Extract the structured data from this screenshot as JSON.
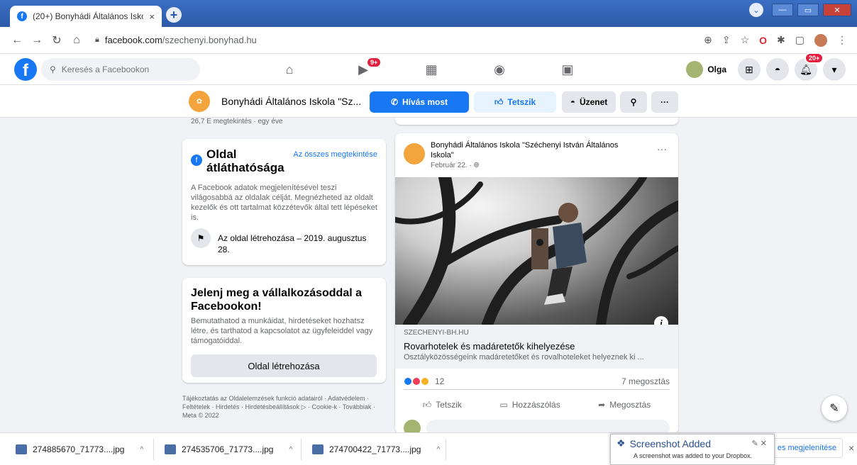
{
  "browser": {
    "tab_title": "(20+) Bonyhádi Általános Iskola ",
    "tab_close": "×",
    "new_tab": "+",
    "url_host": "facebook.com",
    "url_path": "/szechenyi.bonyhad.hu"
  },
  "fbnav": {
    "logo": "f",
    "search_placeholder": "Keresés a Facebookon",
    "watch_badge": "9+",
    "user_name": "Olga",
    "notif_badge": "20+"
  },
  "pagebar": {
    "page_name": "Bonyhádi Általános Iskola \"Sz...",
    "call_label": "Hívás most",
    "like_label": "Tetszik",
    "message_label": "Üzenet"
  },
  "leftcol": {
    "views_stub": "26,7 E megtekintés · egy éve",
    "transparency": {
      "title": "Oldal átláthatósága",
      "see_all": "Az összes megtekintése",
      "description": "A Facebook adatok megjelenítésével teszi világosabbá az oldalak célját. Megnézheted az oldalt kezelők és ott tartalmat közzétevők által tett lépéseket is.",
      "created": "Az oldal létrehozása – 2019. augusztus 28."
    },
    "business": {
      "title": "Jelenj meg a vállalkozásoddal a Facebookon!",
      "description": "Bemutathatod a munkáidat, hirdetéseket hozhatsz létre, és tarthatod a kapcsolatot az ügyfeleiddel vagy támogatóiddal.",
      "button": "Oldal létrehozása"
    },
    "footer": "Tájékoztatás az Oldalelemzések funkció adatairól · Adatvédelem · Feltételek · Hirdetés · Hirdetésbeállítások ▷ · Cookie-k · Továbbiak · Meta © 2022"
  },
  "post": {
    "author": "Bonyhádi Általános Iskola \"Széchenyi István Általános Iskola\"",
    "date": "Február 22. · ",
    "more": "···",
    "link_domain": "SZECHENYI-BH.HU",
    "link_title": "Rovarhotelek és madáretetők kihelyezése",
    "link_desc": "Osztályközösségeink madáretetőket és rovalhoteleket helyeznek ki ...",
    "reaction_count": "12",
    "share_count": "7 megosztás",
    "actions": {
      "like": "Tetszik",
      "comment": "Hozzászólás",
      "share": "Megosztás"
    }
  },
  "downloads": {
    "items": [
      "274885670_71773....jpg",
      "274535706_71773....jpg",
      "274700422_71773....jpg"
    ],
    "show_all": "es megjelenítése",
    "close": "×"
  },
  "toast": {
    "title": "Screenshot Added",
    "message": "A screenshot was added to your Dropbox."
  },
  "colors": {
    "fb_blue": "#1877f2",
    "badge_red": "#e41e3f"
  }
}
